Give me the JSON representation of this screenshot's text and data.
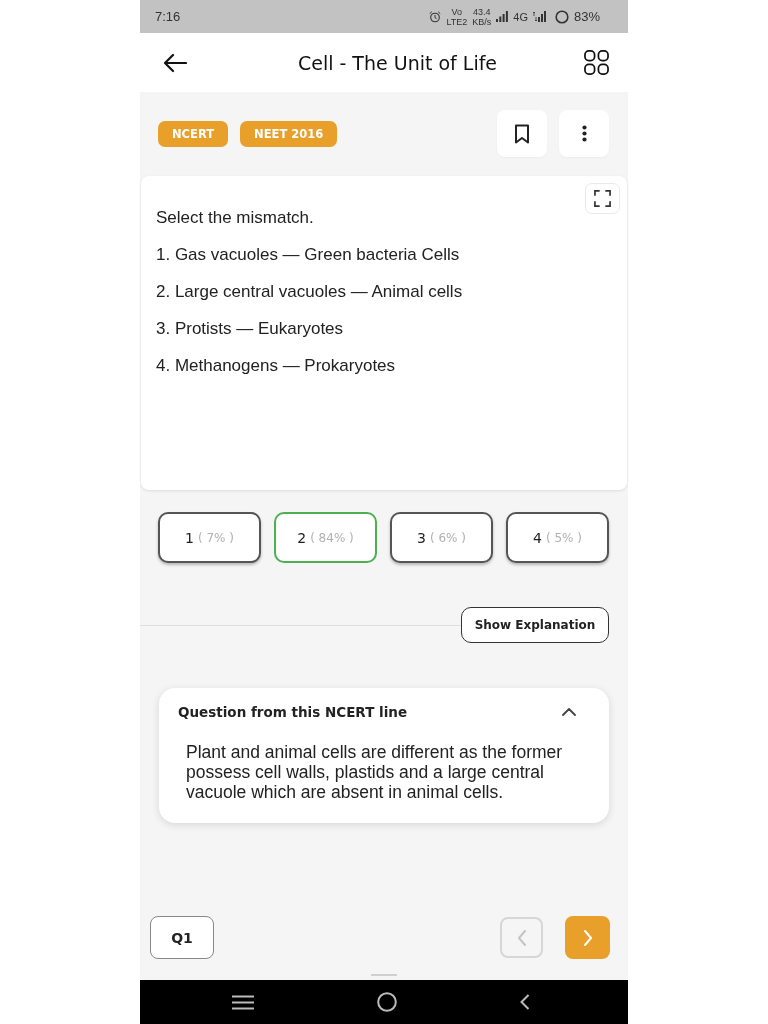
{
  "status_bar": {
    "time": "7:16",
    "volte_top": "Vo",
    "volte_bottom": "LTE2",
    "speed_value": "43.4",
    "speed_unit": "KB/s",
    "network_type": "4G",
    "battery": "83%"
  },
  "header": {
    "title": "Cell - The Unit of Life"
  },
  "tags": [
    {
      "label": "NCERT"
    },
    {
      "label": "NEET 2016"
    }
  ],
  "question": {
    "prompt": "Select the mismatch.",
    "statements": [
      "1. Gas vacuoles — Green bacteria Cells",
      "2. Large central vacuoles — Animal cells",
      "3. Protists — Eukaryotes",
      "4. Methanogens — Prokaryotes"
    ]
  },
  "options": [
    {
      "number": "1",
      "share": "( 7% )",
      "selected": false
    },
    {
      "number": "2",
      "share": "( 84% )",
      "selected": true
    },
    {
      "number": "3",
      "share": "( 6% )",
      "selected": false
    },
    {
      "number": "4",
      "share": "( 5% )",
      "selected": false
    }
  ],
  "explanation_button": {
    "label": "Show Explanation"
  },
  "ncert_line": {
    "title": "Question from this NCERT line",
    "expanded": true,
    "text": "Plant and animal cells are different as the former possess cell walls, plastids and a large central vacuole which are absent in animal cells."
  },
  "footer": {
    "question_label": "Q1",
    "previous_disabled": true
  }
}
